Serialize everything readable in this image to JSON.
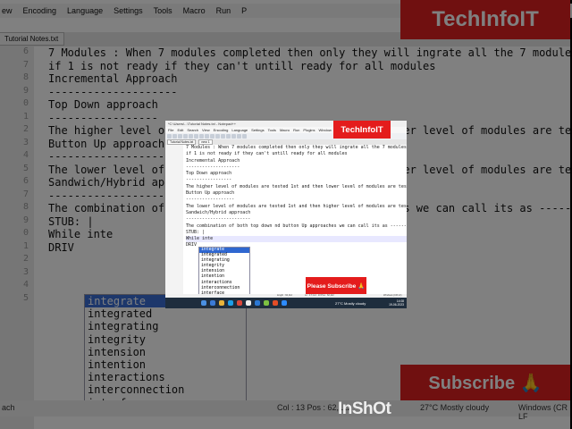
{
  "app": {
    "title": "*C:\\Users\\...\\Tutorial Notes.txt - Notepad++",
    "menu": [
      "File",
      "Edit",
      "Search",
      "View",
      "Encoding",
      "Language",
      "Settings",
      "Tools",
      "Macro",
      "Run",
      "Plugins",
      "Window",
      "?"
    ],
    "tabs": [
      "Tutorial Notes.txt",
      "new 1"
    ]
  },
  "editor": {
    "lines": [
      "7 Modules : When 7 modules completed then only they will ingrate all the 7 modules",
      "if 1 is not ready if they can't untill ready for all modules",
      "",
      "Incremental Approach",
      "--------------------",
      "Top Down approach",
      "-----------------",
      "The higher level of modules are tested 1st and then lower level of modules are tested",
      "",
      "Button Up approach",
      "------------------",
      "The lower level of modules are tested 1st and then higher level of modules are tested",
      "",
      "Sandwich/Hybrid approach",
      "------------------------",
      "The combination of both top down nd button Up approaches we can call its as -------",
      "",
      "STUB: |",
      "While inte",
      "DRIV"
    ]
  },
  "autocomplete": {
    "items": [
      "integrate",
      "integrated",
      "integrating",
      "integrity",
      "intension",
      "intention",
      "interactions",
      "interconnection",
      "interface"
    ],
    "selected": "integrate"
  },
  "overlays": {
    "brand": "TechInfoIT",
    "subscribe": "Please Subscribe 🙏",
    "subscribe_big": "Subscribe 🙏",
    "watermark": "InShOt"
  },
  "status": {
    "length": "length : 62,112",
    "position": "Ln : 17   Col : 13   Pos : 62,112",
    "eol": "Windows (CR LF)",
    "weather": "27°C  Mostly cloudy",
    "time": "14:08",
    "date": "19-06-2023"
  },
  "background_fragments": {
    "menu": [
      "ew",
      "Encoding",
      "Language",
      "Settings",
      "Tools",
      "Macro",
      "Run",
      "P"
    ],
    "tab": "Tutorial Notes.txt",
    "gutter": [
      "6",
      "7",
      "8",
      "9",
      "0",
      "1",
      "2",
      "3",
      "4",
      "5",
      "6",
      "7",
      "8",
      "9",
      "0",
      "1",
      "2",
      "3",
      "4",
      "5"
    ],
    "status_left": "ach",
    "status_mid": "Col : 13    Pos : 62,112",
    "status_weather": "27°C  Mostly cloudy",
    "status_right": "Windows (CR LF"
  }
}
